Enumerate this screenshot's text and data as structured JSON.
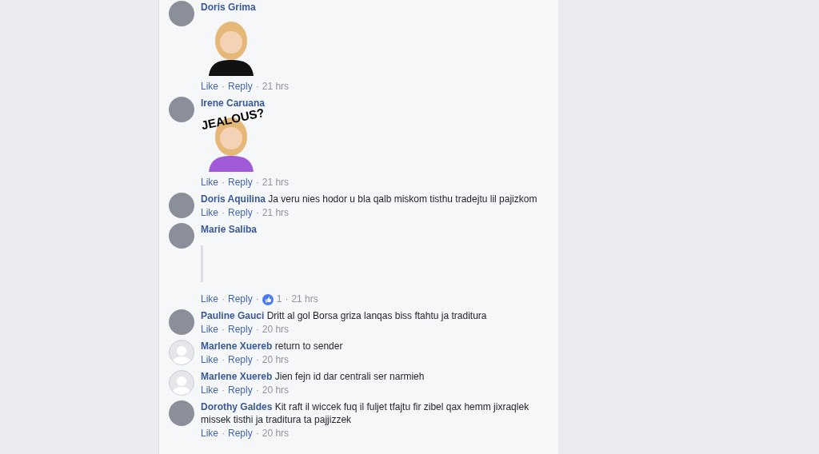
{
  "comments": [
    {
      "author": "Doris Grima",
      "kind": "sticker",
      "default_avatar": false,
      "actions": [
        {
          "kind": "link",
          "text": "Like"
        },
        {
          "kind": "sep",
          "text": "·"
        },
        {
          "kind": "link",
          "text": "Reply"
        },
        {
          "kind": "sep",
          "text": "·"
        },
        {
          "kind": "time",
          "text": "21 hrs"
        }
      ]
    },
    {
      "author": "Irene Caruana",
      "kind": "sticker",
      "default_avatar": false,
      "sticker_caption": "JEALOUS?",
      "actions": [
        {
          "kind": "link",
          "text": "Like"
        },
        {
          "kind": "sep",
          "text": "·"
        },
        {
          "kind": "link",
          "text": "Reply"
        },
        {
          "kind": "sep",
          "text": "·"
        },
        {
          "kind": "time",
          "text": "21 hrs"
        }
      ]
    },
    {
      "author": "Doris Aquilina",
      "kind": "text",
      "default_avatar": false,
      "text": "Ja veru nies hodor u bla qalb miskom tisthu tradejtu lil pajizkom",
      "actions": [
        {
          "kind": "link",
          "text": "Like"
        },
        {
          "kind": "sep",
          "text": "·"
        },
        {
          "kind": "link",
          "text": "Reply"
        },
        {
          "kind": "sep",
          "text": "·"
        },
        {
          "kind": "time",
          "text": "21 hrs"
        }
      ]
    },
    {
      "author": "Marie Saliba",
      "kind": "gif",
      "default_avatar": false,
      "actions": [
        {
          "kind": "link",
          "text": "Like"
        },
        {
          "kind": "sep",
          "text": "·"
        },
        {
          "kind": "link",
          "text": "Reply"
        },
        {
          "kind": "sep",
          "text": "·"
        },
        {
          "kind": "reaction",
          "text": "1"
        },
        {
          "kind": "sep",
          "text": "·"
        },
        {
          "kind": "time",
          "text": "21 hrs"
        }
      ]
    },
    {
      "author": "Pauline Gauci",
      "kind": "text",
      "default_avatar": false,
      "text": "Dritt al gol Borsa griza lanqas biss ftahtu ja traditura",
      "actions": [
        {
          "kind": "link",
          "text": "Like"
        },
        {
          "kind": "sep",
          "text": "·"
        },
        {
          "kind": "link",
          "text": "Reply"
        },
        {
          "kind": "sep",
          "text": "·"
        },
        {
          "kind": "time",
          "text": "20 hrs"
        }
      ]
    },
    {
      "author": "Marlene Xuereb",
      "kind": "text",
      "default_avatar": true,
      "text": "return to sender",
      "actions": [
        {
          "kind": "link",
          "text": "Like"
        },
        {
          "kind": "sep",
          "text": "·"
        },
        {
          "kind": "link",
          "text": "Reply"
        },
        {
          "kind": "sep",
          "text": "·"
        },
        {
          "kind": "time",
          "text": "20 hrs"
        }
      ]
    },
    {
      "author": "Marlene Xuereb",
      "kind": "text",
      "default_avatar": true,
      "text": "Jien fejn id dar centrali ser narmieh",
      "actions": [
        {
          "kind": "link",
          "text": "Like"
        },
        {
          "kind": "sep",
          "text": "·"
        },
        {
          "kind": "link",
          "text": "Reply"
        },
        {
          "kind": "sep",
          "text": "·"
        },
        {
          "kind": "time",
          "text": "20 hrs"
        }
      ]
    },
    {
      "author": "Dorothy Galdes",
      "kind": "text",
      "default_avatar": false,
      "text": "Kit raft il wiccek fuq il fuljet tfajtu fir zibel qax hemm jixraqlek missek tisthi ja traditura ta pajjizzek",
      "actions": [
        {
          "kind": "link",
          "text": "Like"
        },
        {
          "kind": "sep",
          "text": "·"
        },
        {
          "kind": "link",
          "text": "Reply"
        },
        {
          "kind": "sep",
          "text": "·"
        },
        {
          "kind": "time",
          "text": "20 hrs"
        }
      ]
    }
  ]
}
